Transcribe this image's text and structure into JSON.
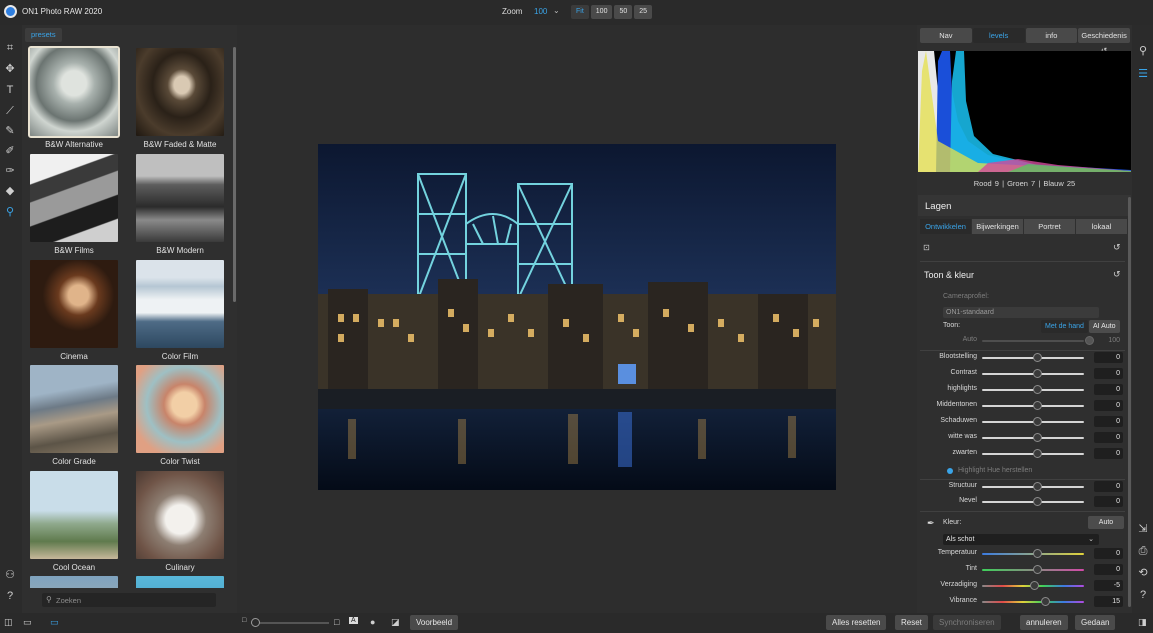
{
  "app": {
    "title": "ON1 Photo RAW 2020"
  },
  "zoom": {
    "label": "Zoom",
    "value": "100",
    "buttons": [
      "Fit",
      "100",
      "50",
      "25"
    ]
  },
  "presets": {
    "tab": "presets",
    "items": [
      {
        "label": "B&W Alternative"
      },
      {
        "label": "B&W Faded & Matte"
      },
      {
        "label": "B&W Films"
      },
      {
        "label": "B&W Modern"
      },
      {
        "label": "Cinema"
      },
      {
        "label": "Color Film"
      },
      {
        "label": "Color Grade"
      },
      {
        "label": "Color Twist"
      },
      {
        "label": "Cool Ocean"
      },
      {
        "label": "Culinary"
      }
    ],
    "search_placeholder": "Zoeken"
  },
  "right_tabs": [
    "Nav",
    "levels",
    "info",
    "Geschiedenis"
  ],
  "rgb": {
    "rood_label": "Rood",
    "rood": "9",
    "groen_label": "| Groen",
    "groen": "7",
    "blauw_label": "| Blauw",
    "blauw": "25"
  },
  "lagen": {
    "title": "Lagen"
  },
  "module_tabs": [
    "Ontwikkelen",
    "Bijwerkingen",
    "Portret",
    "lokaal"
  ],
  "toon": {
    "title": "Toon & kleur",
    "camera_profile_label": "Cameraprofiel:",
    "camera_profile_value": "ON1-standaard",
    "toon_label": "Toon:",
    "mode_manual": "Met de hand",
    "mode_ai": "AI Auto",
    "auto_label": "Auto",
    "auto_value": "100",
    "sliders": [
      {
        "label": "Blootstelling",
        "value": "0"
      },
      {
        "label": "Contrast",
        "value": "0"
      },
      {
        "label": "highlights",
        "value": "0"
      },
      {
        "label": "Middentonen",
        "value": "0"
      },
      {
        "label": "Schaduwen",
        "value": "0"
      },
      {
        "label": "witte was",
        "value": "0"
      },
      {
        "label": "zwarten",
        "value": "0"
      }
    ],
    "highlight_hue": "Highlight Hue herstellen",
    "sliders2": [
      {
        "label": "Structuur",
        "value": "0"
      },
      {
        "label": "Nevel",
        "value": "0"
      }
    ]
  },
  "kleur": {
    "label": "Kleur:",
    "auto_button": "Auto",
    "select_value": "Als schot",
    "sliders": [
      {
        "label": "Temperatuur",
        "value": "0"
      },
      {
        "label": "Tint",
        "value": "0"
      },
      {
        "label": "Verzadiging",
        "value": "-5"
      },
      {
        "label": "Vibrance",
        "value": "15"
      }
    ]
  },
  "bottom": {
    "preview_button": "Voorbeeld",
    "reset_all": "Alles resetten",
    "reset": "Reset",
    "sync": "Synchroniseren",
    "cancel": "annuleren",
    "done": "Gedaan"
  },
  "colors": {
    "accent": "#3aa4e8",
    "panel": "#2f2f2f",
    "background": "#2b2b2b"
  },
  "icons": {
    "tools": [
      "crop-icon",
      "transform-icon",
      "text-icon",
      "retouch-brush-icon",
      "masking-brush-icon",
      "adjustment-brush-icon",
      "perfect-eraser-icon",
      "clone-stamp-icon",
      "zoom-tool-icon",
      "user-icon",
      "help-icon"
    ],
    "right": [
      "browse-icon",
      "edit-sliders-icon",
      "export-icon",
      "print-icon",
      "share-icon",
      "toggle-panel-icon"
    ]
  }
}
